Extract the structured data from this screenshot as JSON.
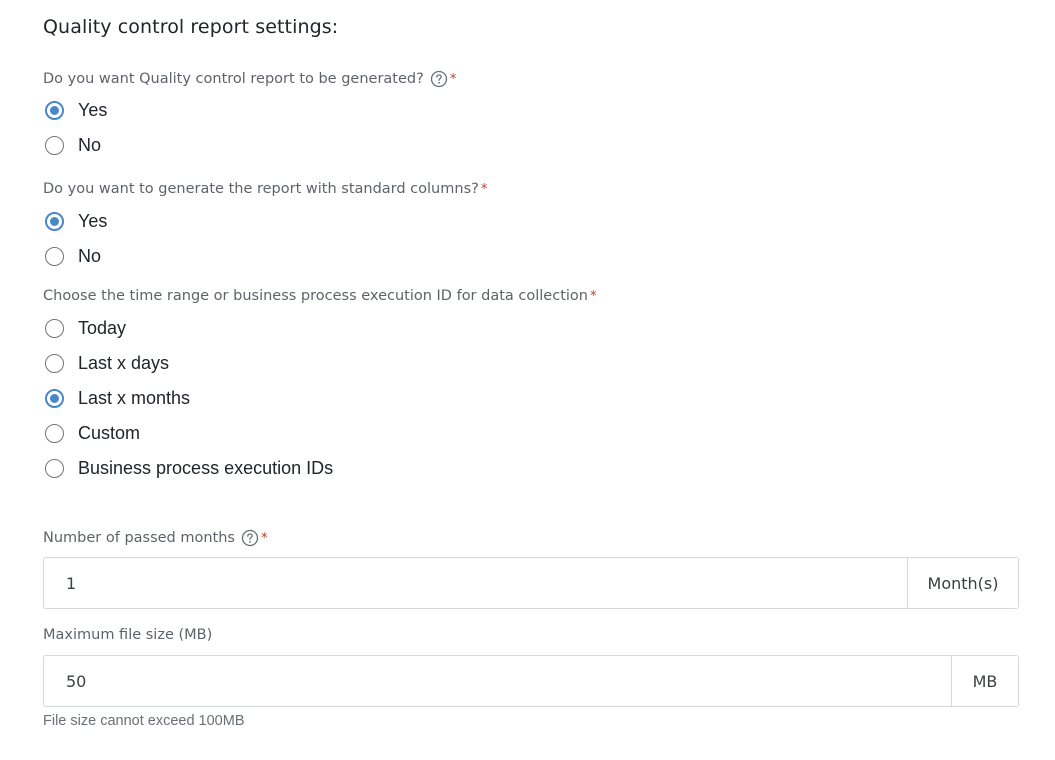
{
  "section": {
    "title": "Quality control report settings:"
  },
  "q1": {
    "question": "Do you want Quality control report to be generated?",
    "required_mark": "*",
    "options": [
      {
        "label": "Yes",
        "checked": true
      },
      {
        "label": "No",
        "checked": false
      }
    ]
  },
  "q2": {
    "question": "Do you want to generate the report with standard columns?",
    "required_mark": "*",
    "options": [
      {
        "label": "Yes",
        "checked": true
      },
      {
        "label": "No",
        "checked": false
      }
    ]
  },
  "q3": {
    "question": "Choose the time range or business process execution ID for data collection",
    "required_mark": "*",
    "options": [
      {
        "label": "Today",
        "checked": false
      },
      {
        "label": "Last x days",
        "checked": false
      },
      {
        "label": "Last x months",
        "checked": true
      },
      {
        "label": "Custom",
        "checked": false
      },
      {
        "label": "Business process execution IDs",
        "checked": false
      }
    ]
  },
  "months_field": {
    "label": "Number of passed months",
    "required_mark": "*",
    "value": "1",
    "unit": "Month(s)"
  },
  "file_size_field": {
    "label": "Maximum file size (MB)",
    "value": "50",
    "unit": "MB",
    "hint": "File size cannot exceed 100MB"
  },
  "icons": {
    "help": "question-circle-icon"
  },
  "colors": {
    "accent": "#4a86c8",
    "required": "#c0392b",
    "muted_text": "#5f6368"
  }
}
